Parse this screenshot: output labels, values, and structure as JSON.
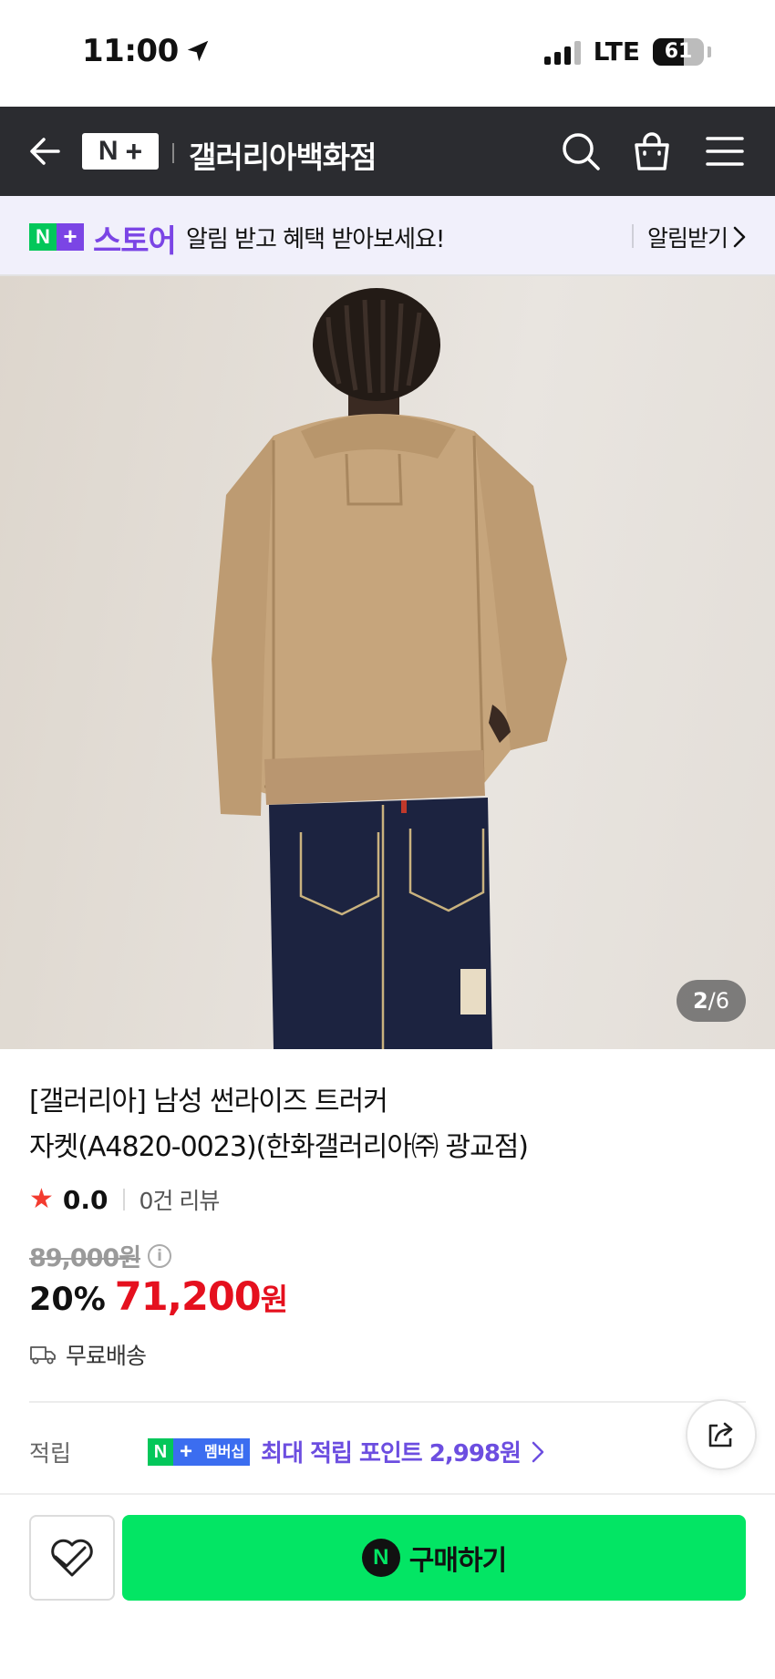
{
  "status_bar": {
    "time": "11:00",
    "network": "LTE",
    "battery": "61",
    "battery_level": 0.61
  },
  "header": {
    "logo_n": "N",
    "logo_plus": "+",
    "title": "갤러리아백화점"
  },
  "store_banner": {
    "badge_n": "N",
    "badge_plus": "+",
    "store_name": "스토어",
    "message": "알림 받고 혜택 받아보세요!",
    "action": "알림받기"
  },
  "image": {
    "current": "2",
    "separator": "/",
    "total": "6"
  },
  "product": {
    "title_line1": "[갤러리아] 남성 썬라이즈 트러커",
    "title_line2": "자켓(A4820-0023)(한화갤러리아㈜ 광교점)",
    "rating": "0.0",
    "reviews": "0건 리뷰",
    "original_price": "89,000원",
    "discount": "20%",
    "price": "71,200",
    "price_unit": "원",
    "shipping": "무료배송"
  },
  "points": {
    "label": "적립",
    "badge_n": "N",
    "badge_plus": "+",
    "badge_text": "멤버십",
    "text": "최대 적립 포인트 2,998원"
  },
  "bottom_bar": {
    "buy_icon": "N",
    "buy_label": "구매하기"
  },
  "colors": {
    "header_bg": "#2b2c30",
    "naver_green": "#03c75a",
    "buy_green": "#03e564",
    "store_purple": "#7b45e5",
    "sale_red": "#e5101e",
    "points_purple": "#6c4ee0"
  }
}
